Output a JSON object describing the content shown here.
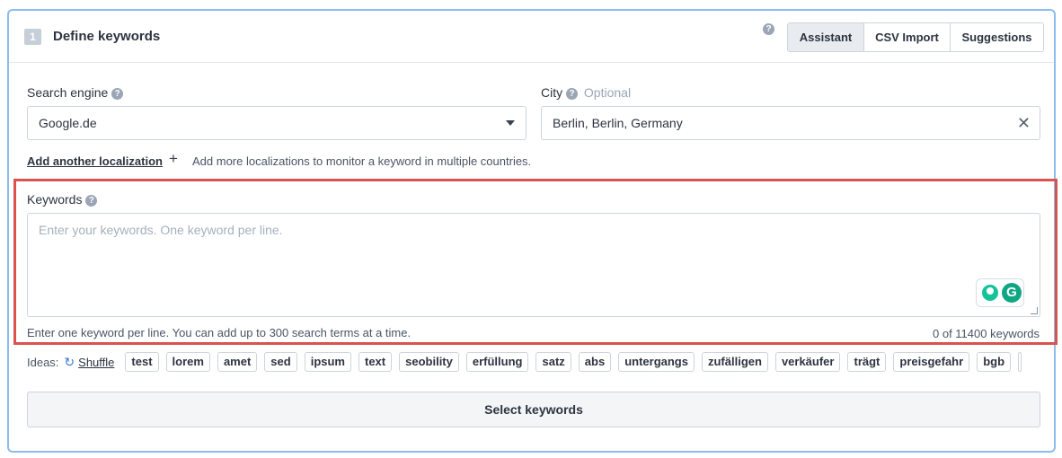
{
  "header": {
    "step_number": "1",
    "title": "Define keywords",
    "help": "?",
    "tabs": [
      {
        "label": "Assistant",
        "active": true
      },
      {
        "label": "CSV Import",
        "active": false
      },
      {
        "label": "Suggestions",
        "active": false
      }
    ]
  },
  "search_engine": {
    "label": "Search engine",
    "help": "?",
    "value": "Google.de"
  },
  "city": {
    "label": "City",
    "help": "?",
    "optional": "Optional",
    "value": "Berlin, Berlin, Germany",
    "clear": "✕"
  },
  "localization": {
    "add_label": "Add another localization",
    "plus": "+",
    "hint": "Add more localizations to monitor a keyword in multiple countries."
  },
  "keywords": {
    "label": "Keywords",
    "help": "?",
    "placeholder": "Enter your keywords. One keyword per line.",
    "hint": "Enter one keyword per line. You can add up to 300 search terms at a time.",
    "count": "0 of 11400 keywords"
  },
  "ideas": {
    "label": "Ideas:",
    "shuffle_icon": "↻",
    "shuffle_label": "Shuffle",
    "chips": [
      "test",
      "lorem",
      "amet",
      "sed",
      "ipsum",
      "text",
      "seobility",
      "erfüllung",
      "satz",
      "abs",
      "untergangs",
      "zufälligen",
      "verkäufer",
      "trägt",
      "preisgefahr",
      "bgb"
    ]
  },
  "grammarly": {
    "letter": "G"
  },
  "select_button": {
    "label": "Select keywords"
  },
  "colors": {
    "panel_border": "#8cbcec",
    "highlight_border": "#d9534f",
    "active_tab_bg": "#e8ecf0",
    "grammarly_green": "#15c39a"
  }
}
